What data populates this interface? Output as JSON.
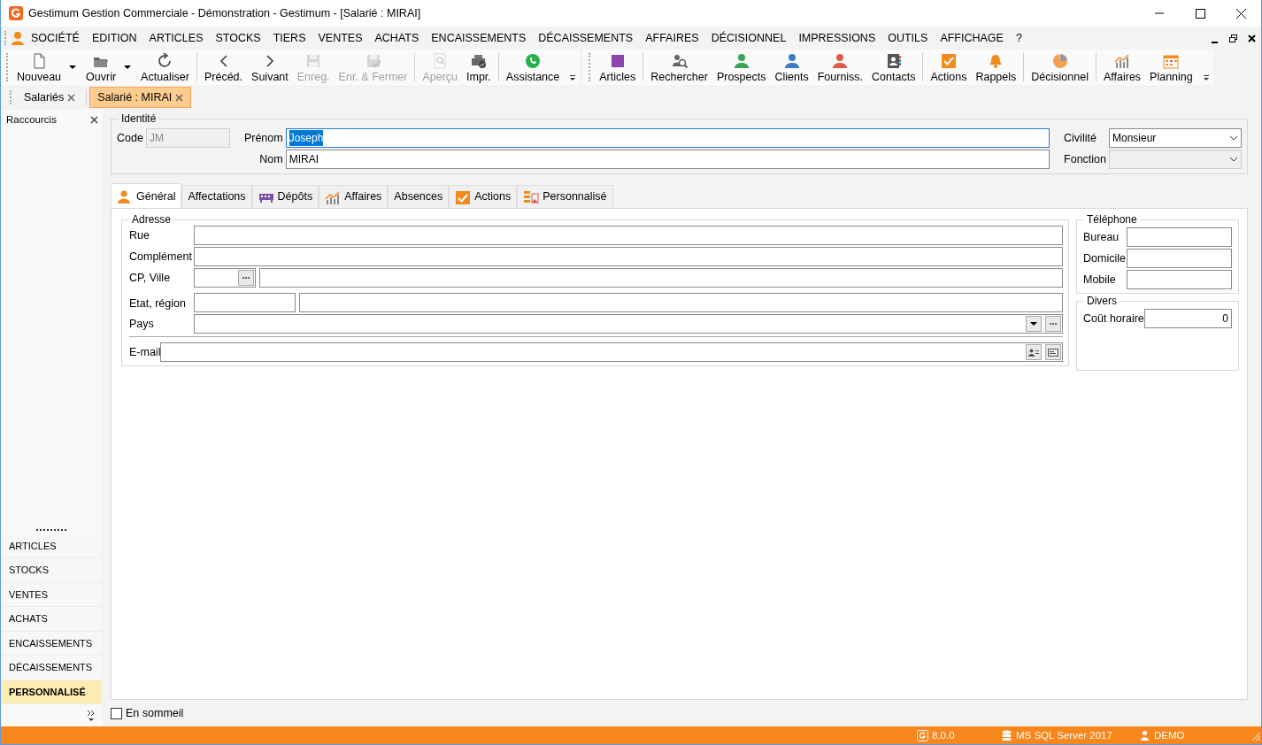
{
  "window": {
    "title": "Gestimum Gestion Commerciale - Démonstration - Gestimum - [Salarié : MIRAI]"
  },
  "menu": [
    "SOCIÉTÉ",
    "EDITION",
    "ARTICLES",
    "STOCKS",
    "TIERS",
    "VENTES",
    "ACHATS",
    "ENCAISSEMENTS",
    "DÉCAISSEMENTS",
    "AFFAIRES",
    "DÉCISIONNEL",
    "IMPRESSIONS",
    "OUTILS",
    "AFFICHAGE",
    "?"
  ],
  "toolbars": [
    {
      "groups": [
        [
          {
            "label": "Nouveau",
            "dropdown": true,
            "disabled": false
          },
          {
            "label": "Ouvrir",
            "dropdown": true,
            "disabled": false
          },
          {
            "label": "Actualiser",
            "dropdown": false,
            "disabled": false
          }
        ],
        [
          {
            "label": "Précéd.",
            "dropdown": false,
            "disabled": false
          },
          {
            "label": "Suivant",
            "dropdown": false,
            "disabled": false
          },
          {
            "label": "Enreg.",
            "dropdown": false,
            "disabled": true
          },
          {
            "label": "Enr. & Fermer",
            "dropdown": false,
            "disabled": true
          }
        ],
        [
          {
            "label": "Aperçu",
            "dropdown": false,
            "disabled": true
          },
          {
            "label": "Impr.",
            "dropdown": false,
            "disabled": false
          }
        ],
        [
          {
            "label": "Assistance",
            "dropdown": false,
            "disabled": false
          }
        ]
      ]
    },
    {
      "groups": [
        [
          {
            "label": "Articles",
            "dropdown": false,
            "disabled": false
          }
        ],
        [
          {
            "label": "Rechercher",
            "dropdown": false,
            "disabled": false
          },
          {
            "label": "Prospects",
            "dropdown": false,
            "disabled": false
          },
          {
            "label": "Clients",
            "dropdown": false,
            "disabled": false
          },
          {
            "label": "Fourniss.",
            "dropdown": false,
            "disabled": false
          },
          {
            "label": "Contacts",
            "dropdown": false,
            "disabled": false
          }
        ],
        [
          {
            "label": "Actions",
            "dropdown": false,
            "disabled": false
          },
          {
            "label": "Rappels",
            "dropdown": false,
            "disabled": false
          }
        ],
        [
          {
            "label": "Décisionnel",
            "dropdown": false,
            "disabled": false
          }
        ],
        [
          {
            "label": "Affaires",
            "dropdown": false,
            "disabled": false
          },
          {
            "label": "Planning",
            "dropdown": false,
            "disabled": false
          }
        ]
      ]
    }
  ],
  "doc_tabs": [
    {
      "label": "Salariés",
      "selected": false
    },
    {
      "label": "Salarié : MIRAI",
      "selected": true
    }
  ],
  "sidebar": {
    "title": "Raccourcis",
    "items": [
      {
        "label": "ARTICLES",
        "selected": false
      },
      {
        "label": "STOCKS",
        "selected": false
      },
      {
        "label": "VENTES",
        "selected": false
      },
      {
        "label": "ACHATS",
        "selected": false
      },
      {
        "label": "ENCAISSEMENTS",
        "selected": false
      },
      {
        "label": "DÉCAISSEMENTS",
        "selected": false
      },
      {
        "label": "PERSONNALISÉ",
        "selected": true
      }
    ]
  },
  "identite": {
    "legend": "Identité",
    "code": {
      "label": "Code",
      "value": "JM",
      "disabled": true
    },
    "prenom": {
      "label": "Prénom",
      "value": "Joseph",
      "text_selected": true
    },
    "nom": {
      "label": "Nom",
      "value": "MIRAI"
    },
    "civilite": {
      "label": "Civilité",
      "value": "Monsieur"
    },
    "fonction": {
      "label": "Fonction",
      "disabled": true
    }
  },
  "tabs": [
    {
      "label": "Général",
      "selected": true
    },
    {
      "label": "Affectations",
      "selected": false
    },
    {
      "label": "Dépôts",
      "selected": false
    },
    {
      "label": "Affaires",
      "selected": false
    },
    {
      "label": "Absences",
      "selected": false
    },
    {
      "label": "Actions",
      "selected": false
    },
    {
      "label": "Personnalisé",
      "selected": false
    }
  ],
  "adresse": {
    "legend": "Adresse",
    "rue": "Rue",
    "complement": "Complément",
    "cp_ville": "CP, Ville",
    "etat_region": "Etat, région",
    "pays": "Pays",
    "email": "E-mail"
  },
  "telephone": {
    "legend": "Téléphone",
    "fields": [
      "Bureau",
      "Domicile",
      "Mobile"
    ]
  },
  "divers": {
    "legend": "Divers",
    "label": "Coût horaire",
    "value": "0"
  },
  "en_sommeil": {
    "label": "En sommeil",
    "checked": false
  },
  "status_bar": {
    "version": "8.0.0",
    "database": "MS SQL Server 2017",
    "user": "DEMO"
  }
}
